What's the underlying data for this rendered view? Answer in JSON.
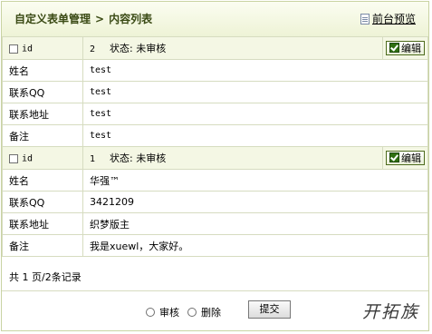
{
  "header": {
    "crumb_parent": "自定义表单管理",
    "crumb_sep": ">",
    "crumb_current": "内容列表",
    "preview_label": "前台预览"
  },
  "records": [
    {
      "id_label": "id",
      "id": "2",
      "status": "状态: 未审核",
      "edit_label": "编辑",
      "fields": [
        {
          "label": "姓名",
          "value": "test"
        },
        {
          "label": "联系QQ",
          "value": "test"
        },
        {
          "label": "联系地址",
          "value": "test"
        },
        {
          "label": "备注",
          "value": "test"
        }
      ]
    },
    {
      "id_label": "id",
      "id": "1",
      "status": "状态: 未审核",
      "edit_label": "编辑",
      "fields": [
        {
          "label": "姓名",
          "value": "华强™"
        },
        {
          "label": "联系QQ",
          "value": "3421209"
        },
        {
          "label": "联系地址",
          "value": "织梦版主"
        },
        {
          "label": "备注",
          "value": "我是xuewl，大家好。"
        }
      ]
    }
  ],
  "summary": "共 1 页/2条记录",
  "actions": {
    "approve_label": "审核",
    "delete_label": "删除",
    "submit_label": "提交"
  },
  "watermark": "开拓族"
}
